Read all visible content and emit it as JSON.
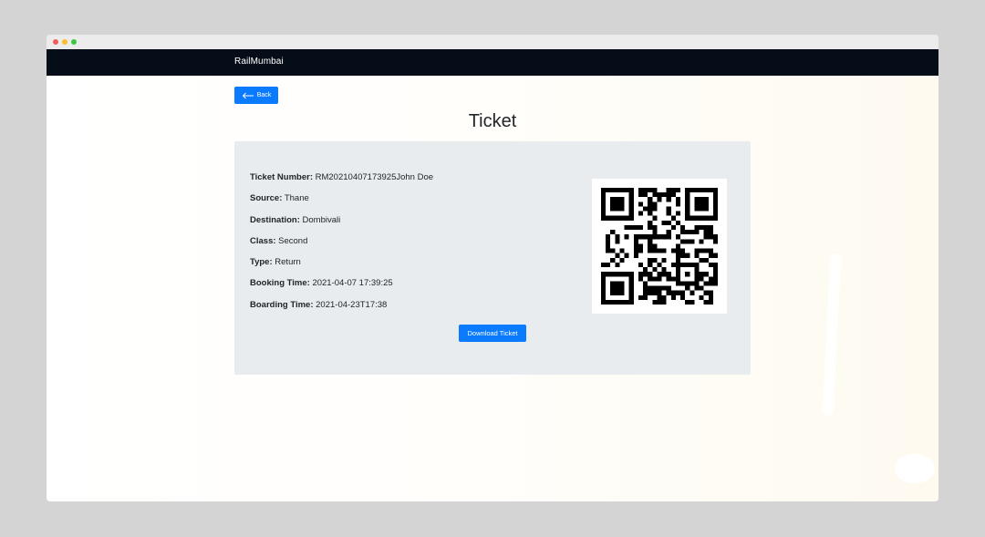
{
  "navbar": {
    "brand": "RailMumbai"
  },
  "back_button": {
    "label": "Back",
    "icon": "arrow-left-icon"
  },
  "page": {
    "title": "Ticket"
  },
  "ticket": {
    "fields": [
      {
        "label": "Ticket Number:",
        "value": "RM20210407173925John Doe"
      },
      {
        "label": "Source:",
        "value": "Thane"
      },
      {
        "label": "Destination:",
        "value": "Dombivali"
      },
      {
        "label": "Class:",
        "value": "Second"
      },
      {
        "label": "Type:",
        "value": "Return"
      },
      {
        "label": "Booking Time:",
        "value": "2021-04-07 17:39:25"
      },
      {
        "label": "Boarding Time:",
        "value": "2021-04-23T17:38"
      }
    ],
    "download_label": "Download Ticket"
  },
  "colors": {
    "navbar": "#050d19",
    "accent": "#0a7bff",
    "card": "#e9ecef"
  }
}
